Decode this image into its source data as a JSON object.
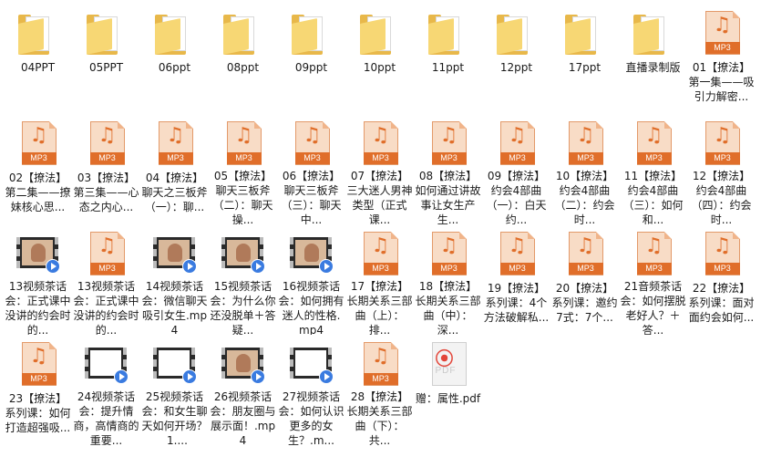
{
  "files": [
    {
      "type": "folder",
      "name": "04PPT"
    },
    {
      "type": "folder",
      "name": "05PPT"
    },
    {
      "type": "folder",
      "name": "06ppt"
    },
    {
      "type": "folder",
      "name": "08ppt"
    },
    {
      "type": "folder",
      "name": "09ppt"
    },
    {
      "type": "folder",
      "name": "10ppt"
    },
    {
      "type": "folder",
      "name": "11ppt"
    },
    {
      "type": "folder",
      "name": "12ppt"
    },
    {
      "type": "folder",
      "name": "17ppt"
    },
    {
      "type": "folder",
      "name": "直播录制版"
    },
    {
      "type": "mp3",
      "name": "01【撩法】第一集——吸引力解密..."
    },
    {
      "type": "mp3",
      "name": "02【撩法】第二集——撩妹核心思..."
    },
    {
      "type": "mp3",
      "name": "03【撩法】第三集——心态之内心..."
    },
    {
      "type": "mp3",
      "name": "04【撩法】聊天之三板斧（一）：聊..."
    },
    {
      "type": "mp3",
      "name": "05【撩法】聊天三板斧（二）：聊天操..."
    },
    {
      "type": "mp3",
      "name": "06【撩法】聊天三板斧（三）：聊天中..."
    },
    {
      "type": "mp3",
      "name": "07【撩法】三大迷人男神类型（正式课..."
    },
    {
      "type": "mp3",
      "name": "08【撩法】如何通过讲故事让女生产生..."
    },
    {
      "type": "mp3",
      "name": "09【撩法】约会4部曲（一）：白天约..."
    },
    {
      "type": "mp3",
      "name": "10【撩法】约会4部曲（二）：约会时..."
    },
    {
      "type": "mp3",
      "name": "11【撩法】约会4部曲（三）：如何和..."
    },
    {
      "type": "mp3",
      "name": "12【撩法】约会4部曲（四）：约会时..."
    },
    {
      "type": "video",
      "thumb": true,
      "name": "13视频茶话会：正式课中没讲的约会时的..."
    },
    {
      "type": "mp3",
      "name": "13视频茶话会：正式课中没讲的约会时的..."
    },
    {
      "type": "video",
      "thumb": true,
      "name": "14视频茶话会：微信聊天吸引女生.mp4"
    },
    {
      "type": "video",
      "thumb": true,
      "name": "15视频茶话会：为什么你还没脱单＋答疑..."
    },
    {
      "type": "video",
      "thumb": true,
      "name": "16视频茶话会：如何拥有迷人的性格.mp4"
    },
    {
      "type": "mp3",
      "name": "17【撩法】长期关系三部曲（上）：排..."
    },
    {
      "type": "mp3",
      "name": "18【撩法】长期关系三部曲（中）：深..."
    },
    {
      "type": "mp3",
      "name": "19【撩法】系列课：4个方法破解私..."
    },
    {
      "type": "mp3",
      "name": "20【撩法】系列课：邀约7式：7个..."
    },
    {
      "type": "mp3",
      "name": "21音频茶话会：如何摆脱老好人？＋答..."
    },
    {
      "type": "mp3",
      "name": "22【撩法】系列课：面对面约会如何..."
    },
    {
      "type": "mp3",
      "name": "23【撩法】系列课：如何打造超强吸..."
    },
    {
      "type": "video",
      "thumb": false,
      "name": "24视频茶话会：提升情商，高情商的重要..."
    },
    {
      "type": "video",
      "thumb": false,
      "name": "25视频茶话会：和女生聊天如何开场？_1...."
    },
    {
      "type": "video",
      "thumb": true,
      "name": "26视频茶话会：朋友圈与展示面！.mp4"
    },
    {
      "type": "video",
      "thumb": false,
      "name": "27视频茶话会：如何认识更多的女生？.m..."
    },
    {
      "type": "mp3",
      "name": "28【撩法】长期关系三部曲（下）：共..."
    },
    {
      "type": "pdf",
      "name": "赠：属性.pdf"
    }
  ],
  "icon_labels": {
    "mp3": "MP3",
    "pdf": "PDF"
  },
  "colors": {
    "folder": "#f7d774",
    "mp3_badge": "#e06e2a",
    "pdf_red": "#e3463a",
    "play_blue": "#3a7be0"
  }
}
